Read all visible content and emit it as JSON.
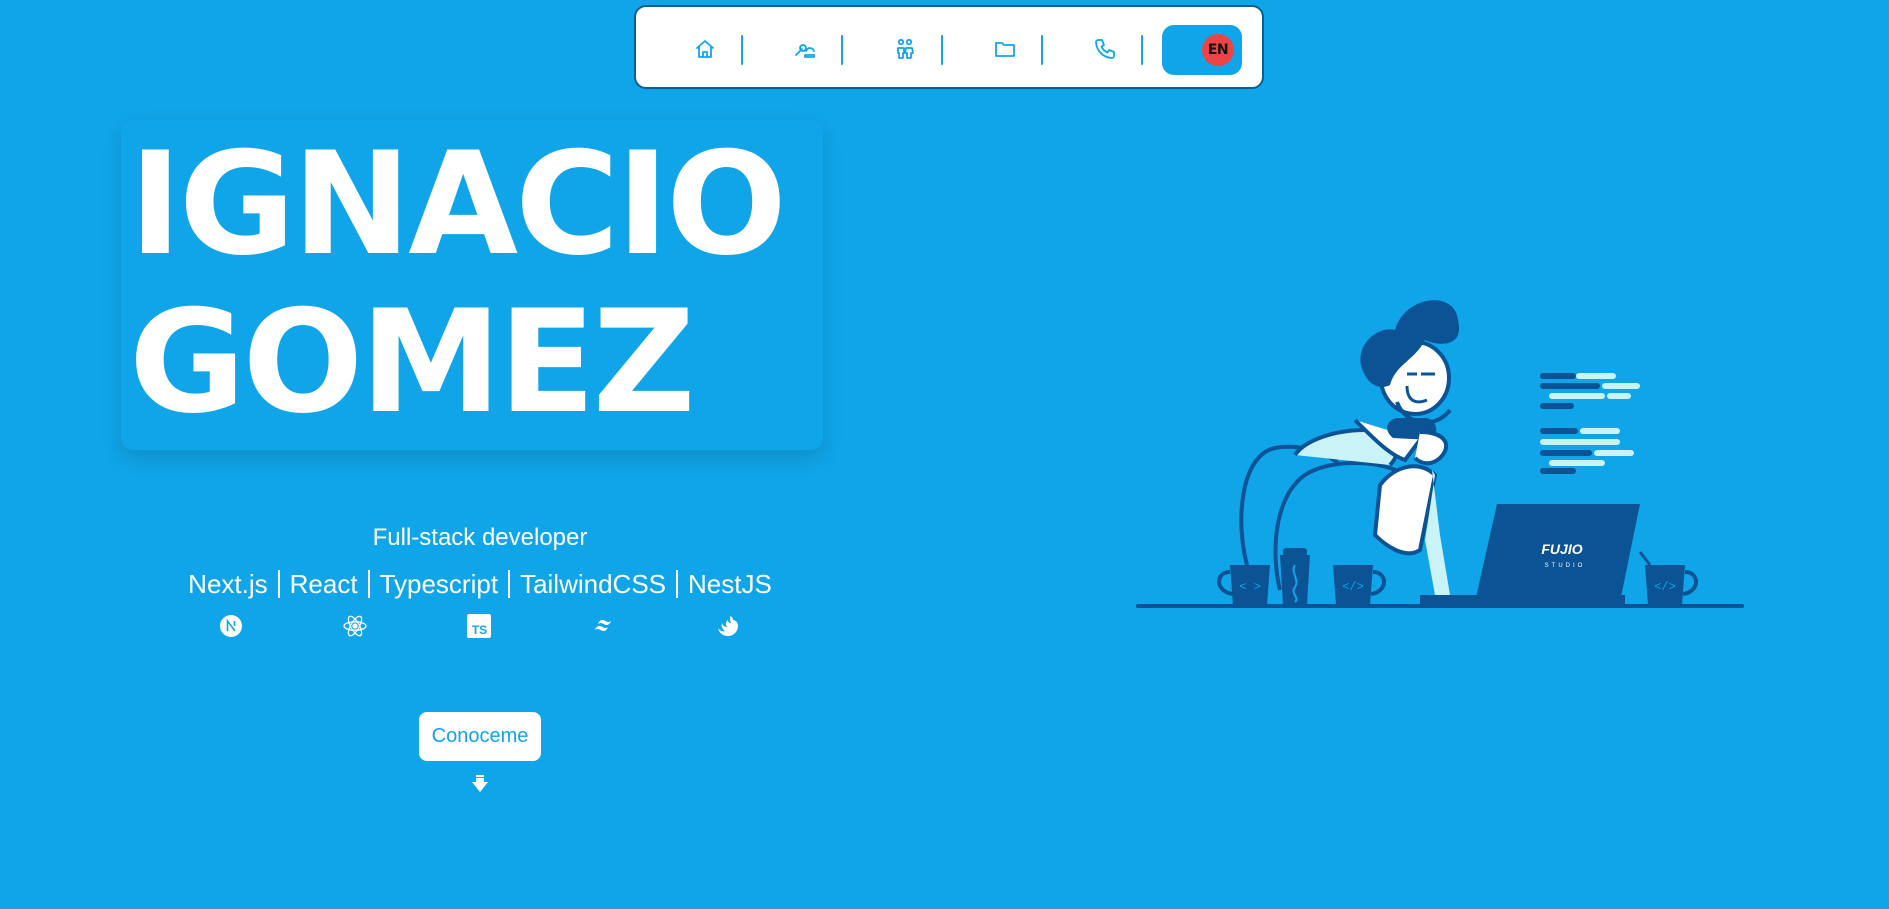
{
  "nav": {
    "items": [
      {
        "name": "home",
        "icon": "home-icon"
      },
      {
        "name": "skills",
        "icon": "tools-icon"
      },
      {
        "name": "about",
        "icon": "people-icon"
      },
      {
        "name": "projects",
        "icon": "folder-icon"
      },
      {
        "name": "contact",
        "icon": "phone-icon"
      }
    ],
    "language_label": "EN",
    "icon_color": "#10a5e9",
    "toggle_knob_color": "#ef4444"
  },
  "hero": {
    "first_name": "IGNACIO",
    "last_name": "GOMEZ",
    "role": "Full-stack developer",
    "stack": [
      "Next.js",
      "React",
      "Typescript",
      "TailwindCSS",
      "NestJS"
    ],
    "stack_icons": [
      "nextjs-icon",
      "react-icon",
      "typescript-icon",
      "tailwind-icon",
      "nestjs-icon"
    ],
    "typescript_badge": "TS",
    "cta_label": "Conoceme",
    "scroll_hint_icon": "arrow-down-icon"
  },
  "illustration": {
    "brand_text": "FUJIO",
    "brand_subtext": "STUDIO",
    "code_mug_label": "</>",
    "code_mug_label_2": "< >"
  },
  "colors": {
    "background": "#10a5e9",
    "dark_blue": "#0b5394",
    "light_cyan": "#c9f3f7",
    "white": "#ffffff"
  }
}
